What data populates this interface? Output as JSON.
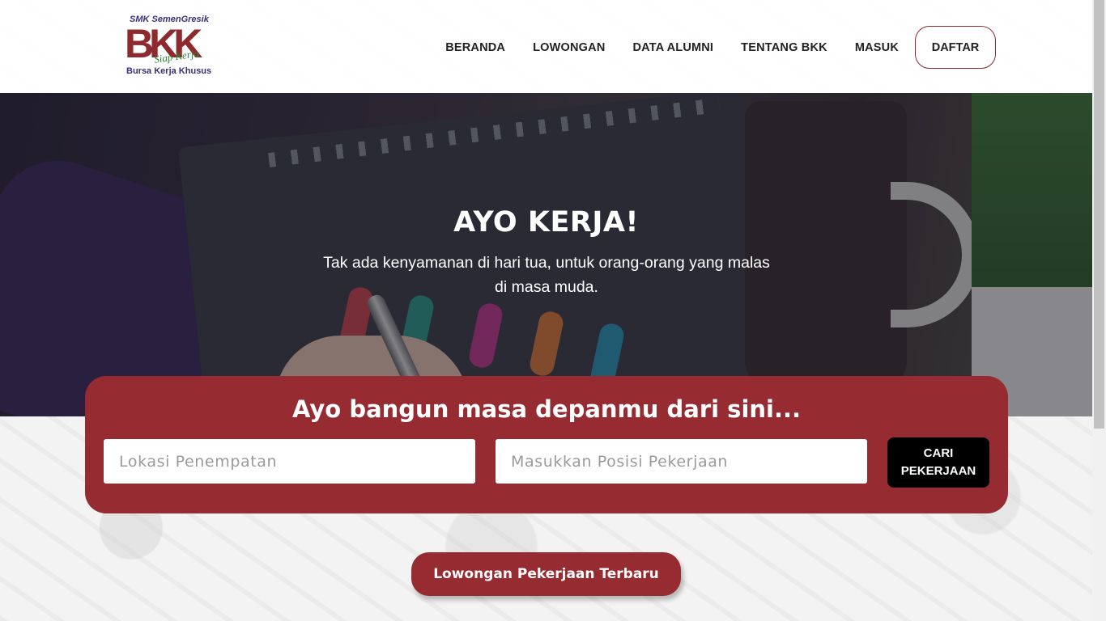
{
  "logo": {
    "line1": "SMK SemenGresik",
    "main": "BKK",
    "tagline": "Siap Kerja",
    "subtitle": "Bursa Kerja Khusus"
  },
  "nav": {
    "items": [
      {
        "label": "BERANDA"
      },
      {
        "label": "LOWONGAN"
      },
      {
        "label": "DATA ALUMNI"
      },
      {
        "label": "TENTANG BKK"
      },
      {
        "label": "MASUK"
      }
    ],
    "register_label": "DAFTAR"
  },
  "hero": {
    "title": "AYO KERJA!",
    "subtitle": "Tak ada kenyamanan di hari tua, untuk orang-orang yang malas di masa muda."
  },
  "search": {
    "title": "Ayo bangun masa depanmu dari sini...",
    "location_placeholder": "Lokasi Penempatan",
    "position_placeholder": "Masukkan Posisi Pekerjaan",
    "button_label": "CARI\nPEKERJAAN"
  },
  "latest": {
    "button_label": "Lowongan Pekerjaan Terbaru"
  },
  "colors": {
    "brand": "#962b31",
    "button_dark": "#000000"
  }
}
